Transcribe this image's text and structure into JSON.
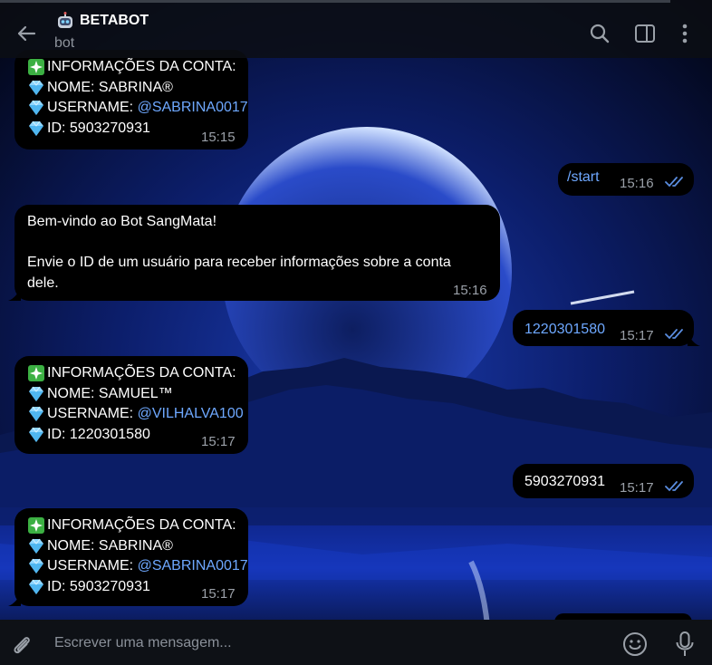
{
  "header": {
    "title": "BETABOT",
    "subtitle": "bot",
    "avatar_icon": "robot-face-icon",
    "icons": [
      "back-arrow-icon",
      "search-icon",
      "sidebar-toggle-icon",
      "more-vertical-icon"
    ]
  },
  "messages": [
    {
      "direction": "in",
      "lines": [
        {
          "emoji": "sparkles-icon",
          "text": "INFORMAÇÕES DA CONTA:"
        },
        {
          "emoji": "gem-icon",
          "text": "NOME: SABRINA®"
        },
        {
          "emoji": "gem-icon",
          "text": "USERNAME: ",
          "link": "@SABRINA0017"
        },
        {
          "emoji": "gem-icon",
          "text": "ID: 5903270931"
        }
      ],
      "time": "15:15"
    },
    {
      "direction": "out",
      "text": "/start",
      "time": "15:16",
      "read": true
    },
    {
      "direction": "in",
      "lines": [
        {
          "text": "Bem-vindo ao Bot SangMata!"
        },
        {
          "text": ""
        },
        {
          "text": "Envie o ID de um usuário para receber informações sobre a conta"
        },
        {
          "text": "dele."
        }
      ],
      "time": "15:16"
    },
    {
      "direction": "out",
      "text": "1220301580",
      "time": "15:17",
      "read": true
    },
    {
      "direction": "in",
      "lines": [
        {
          "emoji": "sparkles-icon",
          "text": "INFORMAÇÕES DA CONTA:"
        },
        {
          "emoji": "gem-icon",
          "text": "NOME: SAMUEL™"
        },
        {
          "emoji": "gem-icon",
          "text": "USERNAME: ",
          "link": "@VILHALVA100"
        },
        {
          "emoji": "gem-icon",
          "text": "ID: 1220301580"
        }
      ],
      "time": "15:17"
    },
    {
      "direction": "out",
      "text": "5903270931",
      "time": "15:17",
      "read": true
    },
    {
      "direction": "in",
      "lines": [
        {
          "emoji": "sparkles-icon",
          "text": "INFORMAÇÕES DA CONTA:"
        },
        {
          "emoji": "gem-icon",
          "text": "NOME: SABRINA®"
        },
        {
          "emoji": "gem-icon",
          "text": "USERNAME: ",
          "link": "@SABRINA0017"
        },
        {
          "emoji": "gem-icon",
          "text": "ID: 5903270931"
        }
      ],
      "time": "15:17"
    }
  ],
  "composer": {
    "placeholder": "Escrever uma mensagem...",
    "icons": [
      "paperclip-icon",
      "smiley-icon",
      "microphone-icon"
    ]
  },
  "colors": {
    "link": "#6ea8ff",
    "check": "#5a8de0",
    "header_bg": "#0c0e14",
    "bubble_bg": "#000000",
    "sky": "#0b1a5e"
  }
}
